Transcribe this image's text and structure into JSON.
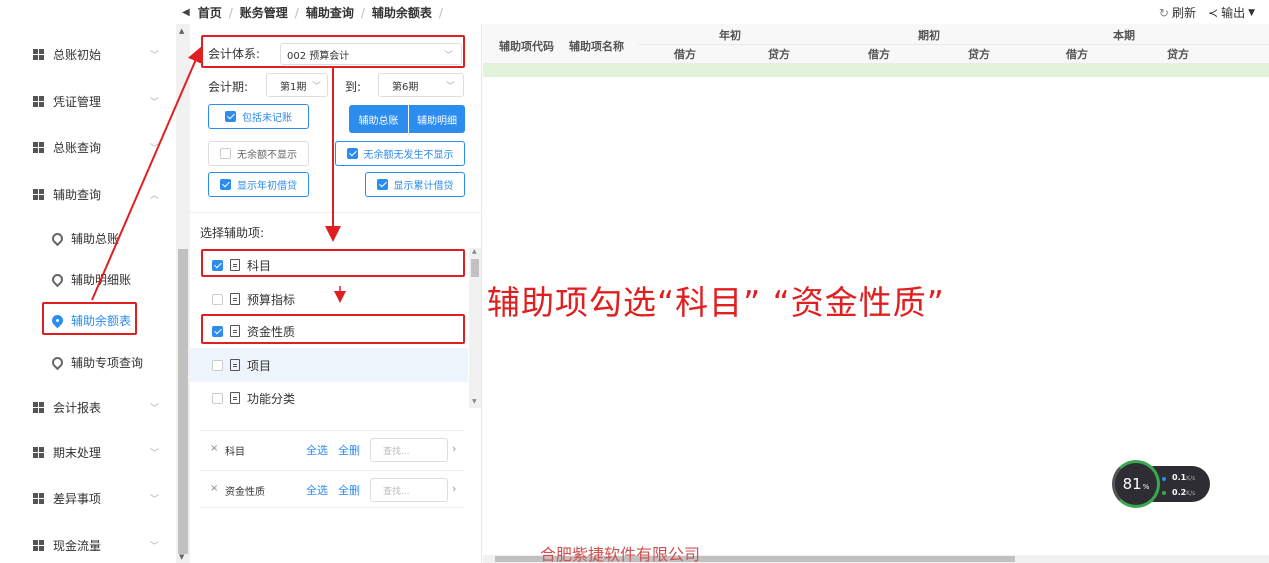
{
  "breadcrumb": {
    "items": [
      "首页",
      "账务管理",
      "辅助查询",
      "辅助余额表"
    ]
  },
  "toolbar": {
    "refresh_label": "刷新",
    "export_label": "输出"
  },
  "sidebar": {
    "items": [
      {
        "label": "总账初始",
        "expanded": false
      },
      {
        "label": "凭证管理",
        "expanded": false
      },
      {
        "label": "总账查询",
        "expanded": false
      },
      {
        "label": "辅助查询",
        "expanded": true
      },
      {
        "label": "会计报表",
        "expanded": false
      },
      {
        "label": "期末处理",
        "expanded": false
      },
      {
        "label": "差异事项",
        "expanded": false
      },
      {
        "label": "现金流量",
        "expanded": false
      }
    ],
    "sub_items": [
      {
        "label": "辅助总账",
        "active": false
      },
      {
        "label": "辅助明细账",
        "active": false
      },
      {
        "label": "辅助余额表",
        "active": true
      },
      {
        "label": "辅助专项查询",
        "active": false
      }
    ]
  },
  "filters": {
    "system_label": "会计体系:",
    "system_value": "002 预算会计",
    "period_label": "会计期:",
    "period_from": "第1期",
    "period_to_label": "到:",
    "period_to": "第6期",
    "include_unposted": "包括未记账",
    "summary_button": "辅助总账",
    "detail_button": "辅助明细",
    "hide_zero_balance": "无余额不显示",
    "hide_zero_both": "无余额无发生不显示",
    "show_opening": "显示年初借贷",
    "show_cumulative": "显示累计借贷"
  },
  "aux_section": {
    "title": "选择辅助项:",
    "items": [
      {
        "label": "科目",
        "checked": true
      },
      {
        "label": "预算指标",
        "checked": false
      },
      {
        "label": "资金性质",
        "checked": true
      },
      {
        "label": "项目",
        "checked": false
      },
      {
        "label": "功能分类",
        "checked": false
      }
    ]
  },
  "selected": {
    "rows": [
      {
        "name": "科目",
        "select_all": "全选",
        "clear_all": "全删",
        "search_placeholder": "查找..."
      },
      {
        "name": "资金性质",
        "select_all": "全选",
        "clear_all": "全删",
        "search_placeholder": "查找..."
      }
    ]
  },
  "table": {
    "col_code": "辅助项代码",
    "col_name": "辅助项名称",
    "groups": [
      "年初",
      "期初",
      "本期"
    ],
    "debit": "借方",
    "credit": "贷方"
  },
  "annotation": {
    "text": "辅助项勾选“科目” “资金性质”",
    "color": "#e02020"
  },
  "watermark": {
    "company": "合肥紫捷软件有限公司"
  },
  "speed_widget": {
    "percent": "81",
    "percent_unit": "%",
    "up": "0.1",
    "down": "0.2",
    "unit": "K/s"
  },
  "colors": {
    "accent": "#2d8cf0",
    "annotation": "#e02020",
    "highlight_row": "#e3f3da"
  }
}
